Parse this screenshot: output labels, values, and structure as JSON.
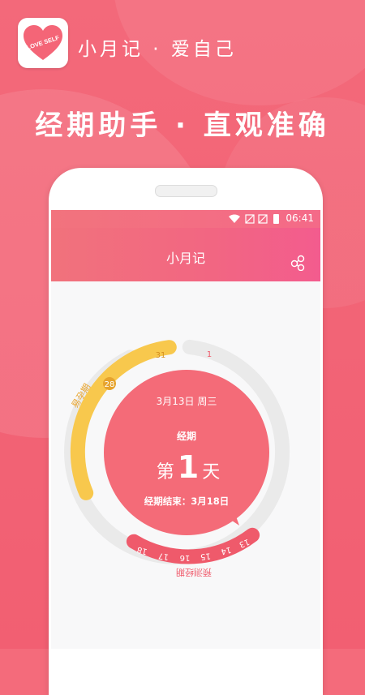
{
  "header": {
    "brand_text": "小月记 · 爱自己",
    "logo_text": "LOVE SELF",
    "tagline": "经期助手 · 直观准确"
  },
  "status_bar": {
    "time": "06:41"
  },
  "app_bar": {
    "title": "小月记",
    "share_icon": "share-icon"
  },
  "cycle": {
    "date_label": "3月13日 周三",
    "phase_label": "经期",
    "day_prefix": "第",
    "day_number": "1",
    "day_suffix": "天",
    "end_label": "经期结束：3月18日",
    "ovulation_label": "易孕期",
    "ovulation_days": [
      "31",
      "28"
    ],
    "cycle_start_day": "1",
    "predicted_label": "预测经期",
    "predicted_days": [
      "18",
      "17",
      "16",
      "15",
      "14",
      "13"
    ]
  },
  "colors": {
    "primary": "#f46b7b",
    "ring_bg": "#e8e8e8",
    "ovulation": "#f7c64b",
    "ovulation_badge": "#e8a32a",
    "period": "#ef5d6f"
  }
}
